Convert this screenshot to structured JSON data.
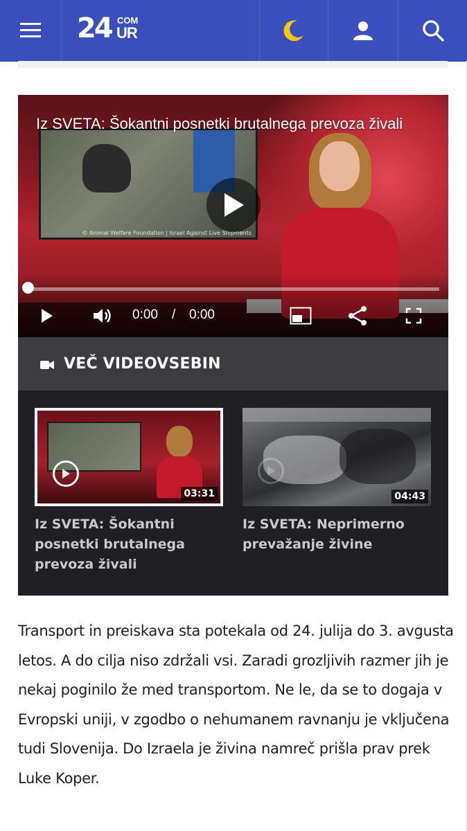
{
  "header": {
    "logo_number": "24",
    "logo_com": "COM",
    "logo_ur": "UR",
    "icons": [
      "menu-icon",
      "moon-icon",
      "user-icon",
      "search-icon"
    ],
    "colors": {
      "background": "#3a4fbb",
      "moon": "#f5c518"
    }
  },
  "player": {
    "title": "Iz SVETA: Šokantni posnetki brutalnega prevoza živali",
    "screen_credit": "© Animal Welfare Foundation | Israel Against Live Shipments",
    "current_time": "0:00",
    "time_separator": "/",
    "duration": "0:00",
    "progress": 0
  },
  "more_videos": {
    "heading": "VEČ VIDEOVSEBIN",
    "items": [
      {
        "title": "Iz SVETA: Šokantni posnetki brutalnega prevoza živali",
        "duration": "03:31",
        "active": true
      },
      {
        "title": "Iz SVETA: Neprimerno prevažanje živine",
        "duration": "04:43",
        "active": false
      }
    ]
  },
  "article": {
    "paragraph": "Transport in preiskava sta potekala od 24. julija do 3. avgusta letos. A do cilja niso zdržali vsi. Zaradi grozljivih razmer jih je nekaj poginilo že med transportom. Ne le, da se to dogaja v Evropski uniji, v zgodbo o nehumanem ravnanju je vključena tudi Slovenija. Do Izraela je živina namreč prišla prav prek Luke Koper."
  }
}
